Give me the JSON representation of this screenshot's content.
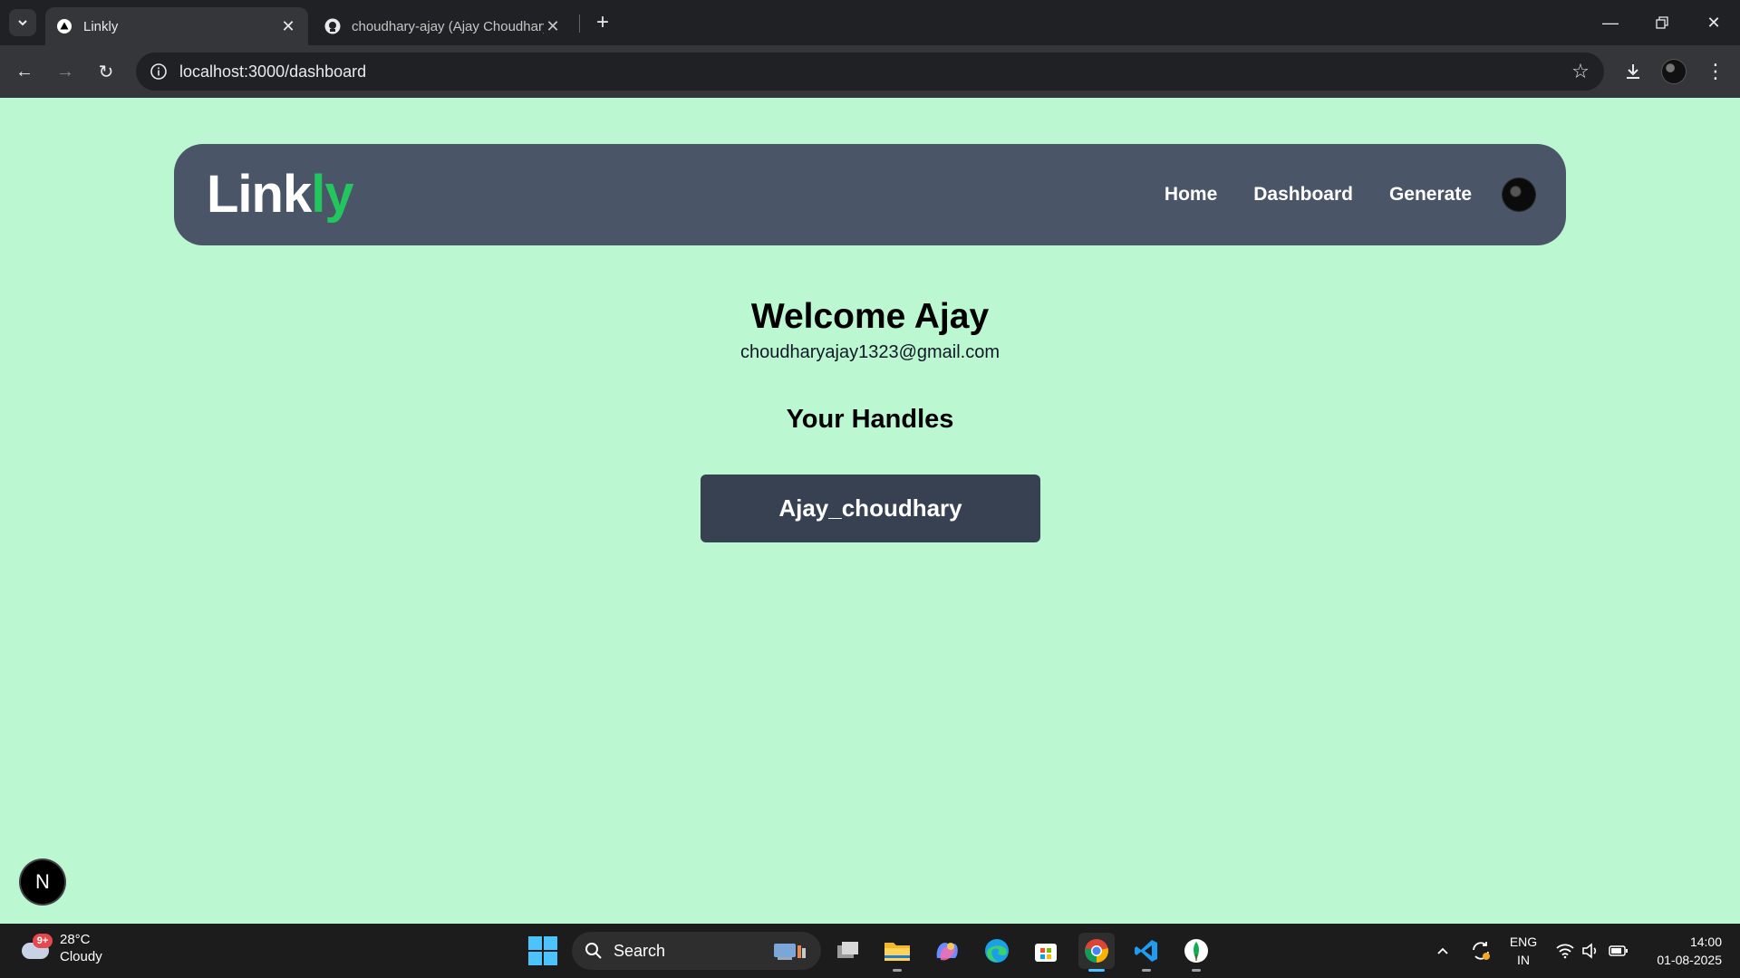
{
  "browser": {
    "tabs": [
      {
        "title": "Linkly",
        "favicon": "triangle-icon",
        "active": true
      },
      {
        "title": "choudhary-ajay (Ajay Choudhary)",
        "favicon": "github-icon",
        "active": false
      }
    ],
    "url": "localhost:3000/dashboard"
  },
  "app": {
    "logo_main": "Link",
    "logo_accent": "ly",
    "nav": {
      "home": "Home",
      "dashboard": "Dashboard",
      "generate": "Generate"
    },
    "colors": {
      "background": "#bbf7d0",
      "navbar": "#4b5568",
      "accent": "#22c55e",
      "handle_button": "#374151"
    }
  },
  "dashboard": {
    "welcome": "Welcome Ajay",
    "email": "choudharyajay1323@gmail.com",
    "handles_title": "Your Handles",
    "handles": [
      "Ajay_choudhary"
    ]
  },
  "dev_badge": {
    "label": "N"
  },
  "taskbar": {
    "weather": {
      "temp": "28°C",
      "condition": "Cloudy",
      "badge": "9+"
    },
    "search_label": "Search",
    "apps": [
      "task-view-icon",
      "file-explorer-icon",
      "copilot-icon",
      "edge-icon",
      "ms-store-icon",
      "chrome-icon",
      "vscode-icon",
      "mongodb-compass-icon"
    ],
    "language": {
      "line1": "ENG",
      "line2": "IN"
    },
    "clock": {
      "time": "14:00",
      "date": "01-08-2025"
    }
  }
}
